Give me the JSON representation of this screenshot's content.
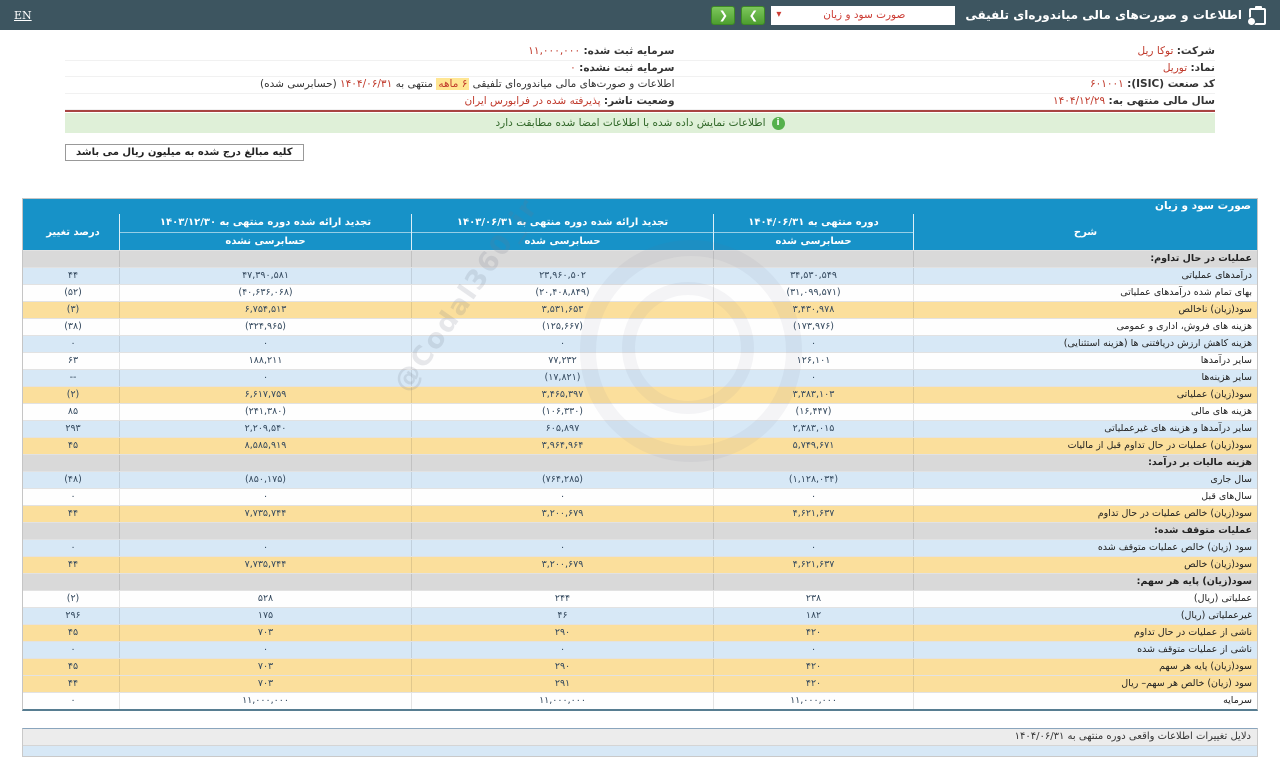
{
  "topbar": {
    "title": "اطلاعات و صورت‌های مالی میاندوره‌ای تلفیقی",
    "statement_select_value": "صورت سود و زیان",
    "select_caret": "▾",
    "nav_forward": "❯",
    "nav_back": "❮",
    "en_label": "EN",
    "bar_color": "#3d5560",
    "accent_green": "#5aad3a"
  },
  "info": {
    "right": [
      {
        "label": "شرکت:",
        "value": "توکا ریل"
      },
      {
        "label": "نماد:",
        "value": "توریل"
      },
      {
        "label": "کد صنعت (ISIC):",
        "value": "۶۰۱۰۰۱"
      },
      {
        "label": "سال مالی منتهی به:",
        "value": "۱۴۰۴/۱۲/۲۹"
      }
    ],
    "left": [
      {
        "label": "سرمایه ثبت شده:",
        "value": "۱۱,۰۰۰,۰۰۰"
      },
      {
        "label": "سرمایه ثبت نشده:",
        "value": "۰"
      },
      {
        "label": "وضعیت ناشر:",
        "value": "پذیرفته شده در فرابورس ایران"
      }
    ],
    "sentence": {
      "prefix": "اطلاعات و صورت‌های مالی میاندوره‌ای تلفیقی",
      "highlight": "۶ ماهه",
      "middle": "منتهی به",
      "date": "۱۴۰۴/۰۶/۳۱",
      "suffix": "(حسابرسی شده)"
    }
  },
  "notice": "اطلاعات نمایش داده شده با اطلاعات امضا شده مطابقت دارد",
  "notice_icon": "i",
  "unit_note": "کلیه مبالغ درج شده به میلیون ریال می باشد",
  "table": {
    "title": "صورت سود و زیان",
    "title_color": "#1792c8",
    "header": {
      "desc": "شرح",
      "pct": "درصد تغییر",
      "periods": [
        {
          "title": "دوره منتهی به ۱۴۰۴/۰۶/۳۱",
          "audit": "حسابرسی شده"
        },
        {
          "title": "تجدید ارائه شده دوره منتهی به ۱۴۰۳/۰۶/۳۱",
          "audit": "حسابرسی شده"
        },
        {
          "title": "تجدید ارائه شده دوره منتهی به ۱۴۰۳/۱۲/۳۰",
          "audit": "حسابرسی نشده"
        }
      ]
    },
    "row_colors": {
      "blue": "#d7e8f6",
      "yellow": "#fbdf9c",
      "section": "#d9d9d9",
      "negative": "#cc0000"
    },
    "rows": [
      {
        "label": "عملیات در حال تداوم:",
        "type": "section"
      },
      {
        "label": "درآمدهای عملیاتی",
        "v1": "۳۴,۵۳۰,۵۴۹",
        "v2": "۲۳,۹۶۰,۵۰۲",
        "v3": "۴۷,۳۹۰,۵۸۱",
        "pct": "۴۴",
        "type": "blue"
      },
      {
        "label": "بهای تمام شده درآمدهای عملیاتی",
        "v1": "(۳۱,۰۹۹,۵۷۱)",
        "v2": "(۲۰,۴۰۸,۸۴۹)",
        "v3": "(۴۰,۶۳۶,۰۶۸)",
        "pct": "(۵۲)",
        "type": "white"
      },
      {
        "label": "سود(زیان) ناخالص",
        "v1": "۳,۴۳۰,۹۷۸",
        "v2": "۳,۵۳۱,۶۵۳",
        "v3": "۶,۷۵۴,۵۱۳",
        "pct": "(۳)",
        "type": "yellow"
      },
      {
        "label": "هزینه های فروش، اداری و عمومی",
        "v1": "(۱۷۳,۹۷۶)",
        "v2": "(۱۲۵,۶۶۷)",
        "v3": "(۳۲۴,۹۶۵)",
        "pct": "(۳۸)",
        "type": "white"
      },
      {
        "label": "هزینه کاهش ارزش دریافتنی ها (هزینه استثنایی)",
        "v1": "۰",
        "v2": "۰",
        "v3": "۰",
        "pct": "۰",
        "type": "blue"
      },
      {
        "label": "سایر درآمدها",
        "v1": "۱۲۶,۱۰۱",
        "v2": "۷۷,۲۳۲",
        "v3": "۱۸۸,۲۱۱",
        "pct": "۶۳",
        "type": "white"
      },
      {
        "label": "سایر هزینه‌ها",
        "v1": "۰",
        "v2": "(۱۷,۸۲۱)",
        "v3": "۰",
        "pct": "--",
        "type": "blue"
      },
      {
        "label": "سود(زیان) عملیاتی",
        "v1": "۳,۳۸۳,۱۰۳",
        "v2": "۳,۴۶۵,۳۹۷",
        "v3": "۶,۶۱۷,۷۵۹",
        "pct": "(۲)",
        "type": "yellow"
      },
      {
        "label": "هزینه های مالی",
        "v1": "(۱۶,۴۴۷)",
        "v2": "(۱۰۶,۳۳۰)",
        "v3": "(۲۴۱,۳۸۰)",
        "pct": "۸۵",
        "type": "white"
      },
      {
        "label": "سایر درآمدها و هزینه های غیرعملیاتی",
        "v1": "۲,۳۸۳,۰۱۵",
        "v2": "۶۰۵,۸۹۷",
        "v3": "۲,۲۰۹,۵۴۰",
        "pct": "۲۹۳",
        "type": "blue"
      },
      {
        "label": "سود(زیان) عملیات در حال تداوم قبل از مالیات",
        "v1": "۵,۷۴۹,۶۷۱",
        "v2": "۳,۹۶۴,۹۶۴",
        "v3": "۸,۵۸۵,۹۱۹",
        "pct": "۴۵",
        "type": "yellow"
      },
      {
        "label": "هزینه مالیات بر درآمد:",
        "type": "section"
      },
      {
        "label": "سال جاری",
        "v1": "(۱,۱۲۸,۰۳۴)",
        "v2": "(۷۶۴,۲۸۵)",
        "v3": "(۸۵۰,۱۷۵)",
        "pct": "(۴۸)",
        "type": "blue"
      },
      {
        "label": "سال‌های قبل",
        "v1": "۰",
        "v2": "۰",
        "v3": "۰",
        "pct": "۰",
        "type": "white"
      },
      {
        "label": "سود(زیان) خالص عملیات در حال تداوم",
        "v1": "۴,۶۲۱,۶۳۷",
        "v2": "۳,۲۰۰,۶۷۹",
        "v3": "۷,۷۳۵,۷۴۴",
        "pct": "۴۴",
        "type": "yellow"
      },
      {
        "label": "عملیات متوقف شده:",
        "type": "section"
      },
      {
        "label": "سود (زیان) خالص عملیات متوقف شده",
        "v1": "۰",
        "v2": "۰",
        "v3": "۰",
        "pct": "۰",
        "type": "blue"
      },
      {
        "label": "سود(زیان) خالص",
        "v1": "۴,۶۲۱,۶۳۷",
        "v2": "۳,۲۰۰,۶۷۹",
        "v3": "۷,۷۳۵,۷۴۴",
        "pct": "۴۴",
        "type": "yellow"
      },
      {
        "label": "سود(زیان) پایه هر سهم:",
        "type": "section"
      },
      {
        "label": "عملیاتی (ریال)",
        "v1": "۲۳۸",
        "v2": "۲۴۴",
        "v3": "۵۲۸",
        "pct": "(۲)",
        "type": "white"
      },
      {
        "label": "غیرعملیاتی (ریال)",
        "v1": "۱۸۲",
        "v2": "۴۶",
        "v3": "۱۷۵",
        "pct": "۲۹۶",
        "type": "blue"
      },
      {
        "label": "ناشی از عملیات در حال تداوم",
        "v1": "۴۲۰",
        "v2": "۲۹۰",
        "v3": "۷۰۳",
        "pct": "۴۵",
        "type": "yellow"
      },
      {
        "label": "ناشی از عملیات متوقف شده",
        "v1": "۰",
        "v2": "۰",
        "v3": "۰",
        "pct": "۰",
        "type": "blue"
      },
      {
        "label": "سود(زیان) پایه هر سهم",
        "v1": "۴۲۰",
        "v2": "۲۹۰",
        "v3": "۷۰۳",
        "pct": "۴۵",
        "type": "yellow"
      },
      {
        "label": "سود (زیان) خالص هر سهم– ریال",
        "v1": "۴۲۰",
        "v2": "۲۹۱",
        "v3": "۷۰۳",
        "pct": "۴۴",
        "type": "yellow"
      },
      {
        "label": "سرمایه",
        "v1": "۱۱,۰۰۰,۰۰۰",
        "v2": "۱۱,۰۰۰,۰۰۰",
        "v3": "۱۱,۰۰۰,۰۰۰",
        "pct": "۰",
        "type": "white"
      }
    ]
  },
  "bottom_table": {
    "header": "دلایل تغییرات اطلاعات واقعی دوره منتهی به ۱۴۰۴/۰۶/۳۱"
  },
  "watermark": "@Codal360_ir"
}
